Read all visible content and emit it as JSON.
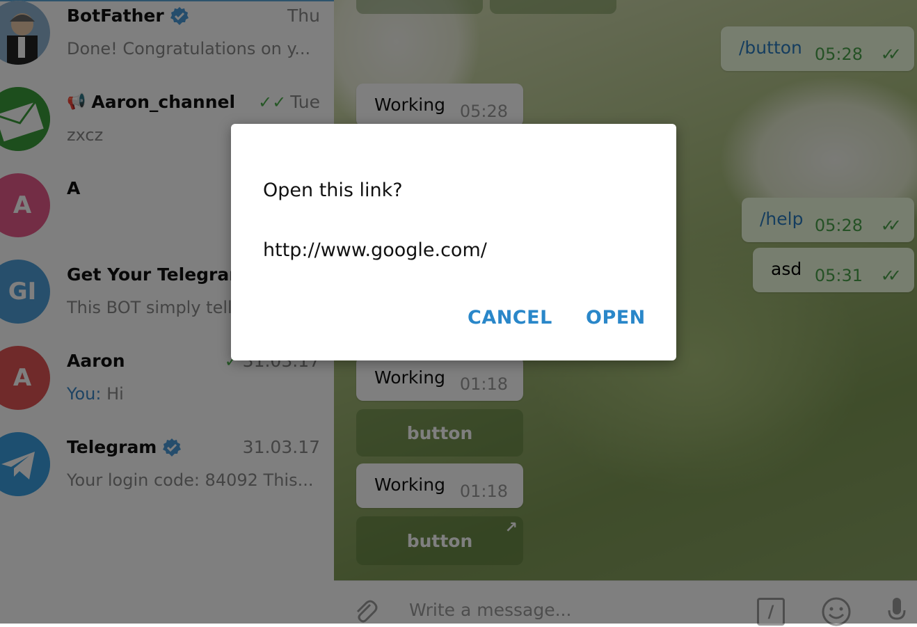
{
  "sidebar": {
    "chats": [
      {
        "title": "BotFather",
        "verified": true,
        "time": "Thu",
        "preview": "Done! Congratulations on y...",
        "avatar_color": "#5a8fb8"
      },
      {
        "title": "Aaron_channel",
        "channel": true,
        "time": "Tue",
        "read_ticks": "✓✓",
        "preview": "zxcz",
        "avatar_color": "#3a9d3a"
      },
      {
        "title": "A",
        "time": "",
        "preview": "",
        "avatar_initials": "A",
        "avatar_color": "#e65a8a"
      },
      {
        "title": "Get Your Telegram",
        "time": "",
        "preview": "This BOT simply tell",
        "avatar_initials": "GI",
        "avatar_color": "#4e9fd8"
      },
      {
        "title": "Aaron",
        "time": "31.03.17",
        "read_ticks": "✓",
        "preview_prefix": "You:",
        "preview": "Hi",
        "avatar_initials": "A",
        "avatar_color": "#e05555"
      },
      {
        "title": "Telegram",
        "verified": true,
        "time": "31.03.17",
        "preview": "Your login code: 84092  This...",
        "avatar_color": "#3a9fe0"
      }
    ]
  },
  "chat": {
    "incoming": [
      {
        "text": "Working",
        "time": "05:28"
      },
      {
        "text": "Working",
        "time": "01:18"
      },
      {
        "text": "Working",
        "time": "01:18"
      }
    ],
    "inline_buttons": [
      {
        "label": "button"
      },
      {
        "label": "button",
        "arrow": "↗"
      }
    ],
    "outgoing": [
      {
        "text": "/button",
        "time": "05:28",
        "ticks": "✓✓"
      },
      {
        "text": "/help",
        "time": "05:28",
        "ticks": "✓✓"
      },
      {
        "text": "asd",
        "time": "05:31",
        "ticks": "✓✓"
      }
    ]
  },
  "input": {
    "placeholder": "Write a message...",
    "attach_icon": "paperclip-icon",
    "commands_icon": "slash-command-icon",
    "emoji_icon": "smiley-icon",
    "mic_icon": "microphone-icon",
    "slash_glyph": "/"
  },
  "dialog": {
    "title": "Open this link?",
    "link": "http://www.google.com/",
    "cancel_label": "CANCEL",
    "open_label": "OPEN"
  },
  "colors": {
    "accent": "#2a87c9",
    "outgoing_bubble": "#effdde",
    "read_check": "#4aa24a"
  }
}
